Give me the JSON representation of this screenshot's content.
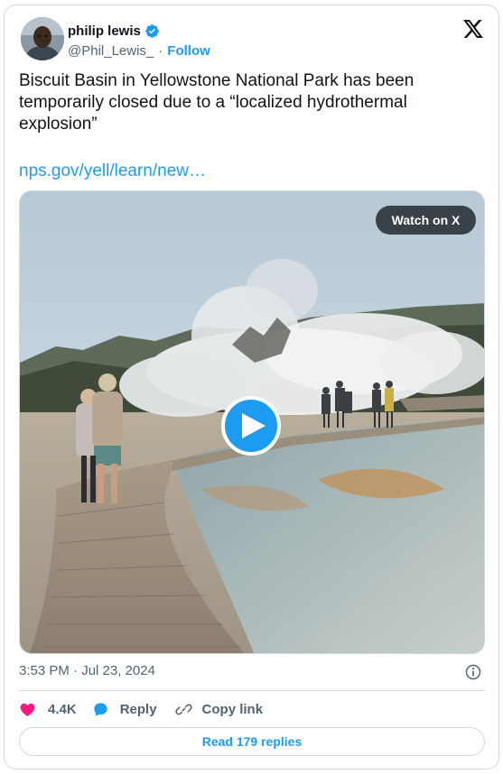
{
  "tweet": {
    "author": {
      "name": "philip lewis",
      "handle": "@Phil_Lewis_",
      "separator": "·",
      "follow_label": "Follow",
      "avatar_icon": "avatar",
      "verified_icon": "verified-badge-icon"
    },
    "platform_icon": "x-logo-icon",
    "text": "Biscuit Basin in Yellowstone National Park has been temporarily closed due to a “localized hydrothermal explosion”",
    "link": "nps.gov/yell/learn/new…",
    "media": {
      "type": "video",
      "watch_label": "Watch on X",
      "play_icon": "play-icon"
    },
    "timestamp": "3:53 PM · Jul 23, 2024",
    "info_icon": "info-icon",
    "actions": {
      "like_count": "4.4K",
      "reply_label": "Reply",
      "copy_label": "Copy link"
    },
    "read_replies_label": "Read 179 replies"
  },
  "colors": {
    "accent": "#1d9bf0",
    "like": "#f91880",
    "text": "#0f1419",
    "muted": "#536471",
    "border": "#cfd9de"
  }
}
